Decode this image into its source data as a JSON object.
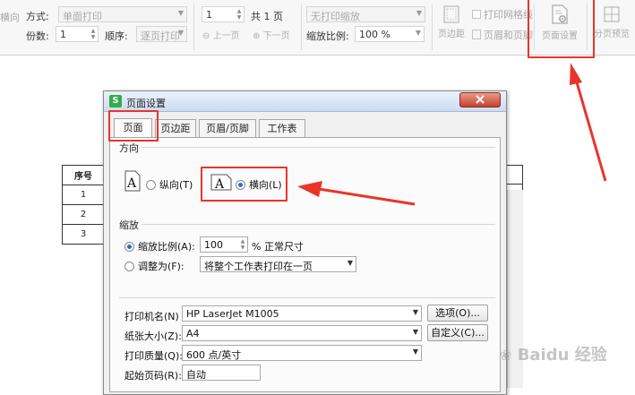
{
  "toolbar": {
    "method_label": "方式:",
    "method_value": "单面打印",
    "copies_label": "份数:",
    "copies_value": "1",
    "order_label": "顺序:",
    "order_value": "逐页打印",
    "page_input": "1",
    "page_total": "共 1 页",
    "prev_page": "上一页",
    "next_page": "下一页",
    "scaling_select": "无打印缩放",
    "zoom_label": "缩放比例:",
    "zoom_value": "100 %",
    "margins_btn": "页边距",
    "print_gridlines": "打印网格线",
    "header_footer": "页眉和页脚",
    "page_setup_btn": "页面设置",
    "page_break_preview": "分页预览"
  },
  "sheet": {
    "header": "序号",
    "rows": [
      "1",
      "2",
      "3"
    ]
  },
  "dialog": {
    "title": "页面设置",
    "app_icon": "S",
    "tabs": [
      "页面",
      "页边距",
      "页眉/页脚",
      "工作表"
    ],
    "orientation_title": "方向",
    "portrait_label": "纵向(T)",
    "landscape_label": "横向(L)",
    "scale_title": "缩放",
    "scale_label": "缩放比例(A):",
    "scale_value": "100",
    "scale_suffix": "% 正常尺寸",
    "fit_label": "调整为(F):",
    "fit_value": "将整个工作表打印在一页",
    "printer_label": "打印机名(N)",
    "printer_value": "HP LaserJet M1005",
    "options_btn": "选项(O)...",
    "paper_label": "纸张大小(Z):",
    "paper_value": "A4",
    "custom_btn": "自定义(C)...",
    "quality_label": "打印质量(Q):",
    "quality_value": "600 点/英寸",
    "start_page_label": "起始页码(R):",
    "start_page_value": "自动"
  },
  "watermark": "Baidu 经验",
  "colors": {
    "highlight_red": "#e8352b",
    "radio_blue": "#2a6ad0"
  }
}
